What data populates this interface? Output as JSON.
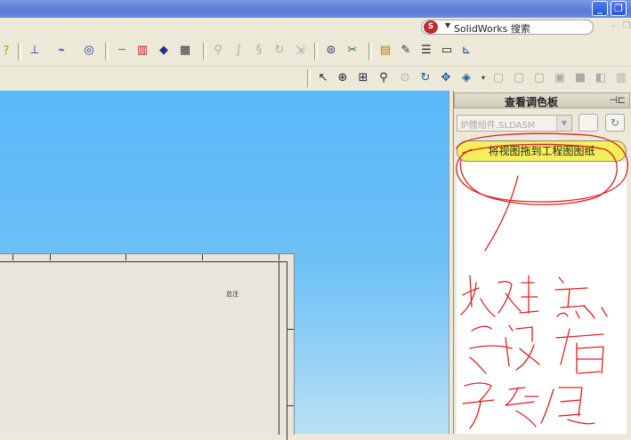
{
  "search": {
    "text": "SolidWorks 搜索",
    "icon": "solidworks-logo-icon"
  },
  "pane": {
    "title": "查看调色板",
    "document_select": "炉膛组件.SLDASM",
    "drag_button_label": "将视图拖到工程图图纸"
  },
  "sheet": {
    "note": "总注"
  },
  "annotation": {
    "handwritten_text": "先打开已有预览"
  },
  "colors": {
    "graphics_top": "#5ab8f8",
    "graphics_bottom": "#b9e0f4",
    "drag_button": "#f6ef5a",
    "scribble": "#e02020"
  }
}
